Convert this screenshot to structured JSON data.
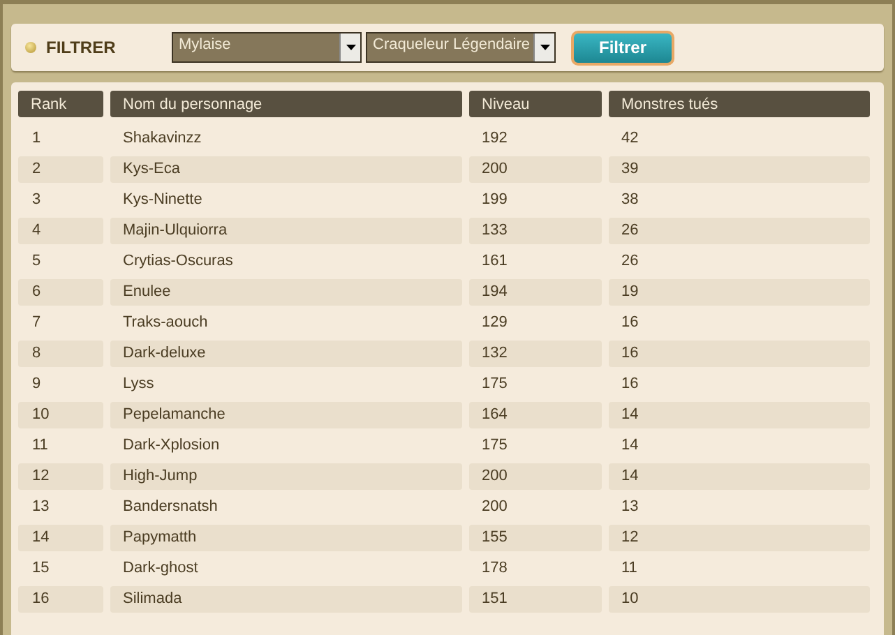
{
  "filter": {
    "label": "FILTRER",
    "server": "Mylaise",
    "monster": "Craqueleur Légendaire",
    "button": "Filtrer"
  },
  "table": {
    "columns": [
      "Rank",
      "Nom du personnage",
      "Niveau",
      "Monstres tués"
    ],
    "rows": [
      [
        "1",
        "Shakavinzz",
        "192",
        "42"
      ],
      [
        "2",
        "Kys-Eca",
        "200",
        "39"
      ],
      [
        "3",
        "Kys-Ninette",
        "199",
        "38"
      ],
      [
        "4",
        "Majin-Ulquiorra",
        "133",
        "26"
      ],
      [
        "5",
        "Crytias-Oscuras",
        "161",
        "26"
      ],
      [
        "6",
        "Enulee",
        "194",
        "19"
      ],
      [
        "7",
        "Traks-aouch",
        "129",
        "16"
      ],
      [
        "8",
        "Dark-deluxe",
        "132",
        "16"
      ],
      [
        "9",
        "Lyss",
        "175",
        "16"
      ],
      [
        "10",
        "Pepelamanche",
        "164",
        "14"
      ],
      [
        "11",
        "Dark-Xplosion",
        "175",
        "14"
      ],
      [
        "12",
        "High-Jump",
        "200",
        "14"
      ],
      [
        "13",
        "Bandersnatsh",
        "200",
        "13"
      ],
      [
        "14",
        "Papymatth",
        "155",
        "12"
      ],
      [
        "15",
        "Dark-ghost",
        "178",
        "11"
      ],
      [
        "16",
        "Silimada",
        "151",
        "10"
      ]
    ]
  }
}
